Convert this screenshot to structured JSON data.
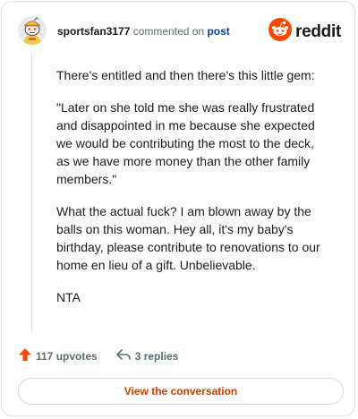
{
  "header": {
    "username": "sportsfan3177",
    "action_text": "commented on",
    "target_link": "post",
    "logo_text": "reddit"
  },
  "comment": {
    "paragraphs": [
      "There's entitled and then there's this little gem:",
      "\"Later on she told me she was really frustrated and disappointed in me because she expected we would be contributing the most to the deck, as we have more money than the other family members.\"",
      "What the actual fuck? I am blown away by the balls on this woman. Hey all, it's my baby's birthday, please contribute to renovations to our home en lieu of a gift. Unbelievable.",
      "NTA"
    ]
  },
  "actions": {
    "upvotes": "117 upvotes",
    "replies": "3 replies"
  },
  "footer": {
    "view_button": "View the conversation"
  },
  "colors": {
    "upvote_arrow": "#ff4500",
    "reddit_brand": "#ff4500",
    "view_button_text": "#d93a00",
    "post_link": "#0a449b"
  },
  "icons": {
    "avatar": "snoo-avatar-icon",
    "logo": "reddit-logo-icon",
    "upvote": "upvote-arrow-icon",
    "reply": "reply-arrow-icon"
  }
}
